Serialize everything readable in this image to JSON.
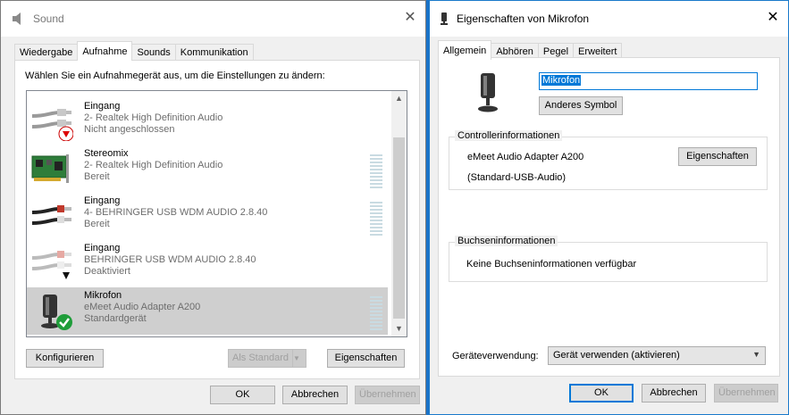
{
  "sound": {
    "title": "Sound",
    "tabs": [
      "Wiedergabe",
      "Aufnahme",
      "Sounds",
      "Kommunikation"
    ],
    "instruction": "Wählen Sie ein Aufnahmegerät aus, um die Einstellungen zu ändern:",
    "devices": [
      {
        "name": "Eingang",
        "desc": "2- Realtek High Definition Audio",
        "status": "Nicht angeschlossen",
        "icon": "rca-cable-icon",
        "badge": "red-down-arrow"
      },
      {
        "name": "Stereomix",
        "desc": "2- Realtek High Definition Audio",
        "status": "Bereit",
        "icon": "sound-card-icon",
        "badge": ""
      },
      {
        "name": "Eingang",
        "desc": "4- BEHRINGER USB WDM AUDIO 2.8.40",
        "status": "Bereit",
        "icon": "rca-cable-icon",
        "badge": ""
      },
      {
        "name": "Eingang",
        "desc": "BEHRINGER USB WDM AUDIO 2.8.40",
        "status": "Deaktiviert",
        "icon": "rca-cable-icon",
        "badge": "black-down-arrow"
      },
      {
        "name": "Mikrofon",
        "desc": "eMeet Audio Adapter A200",
        "status": "Standardgerät",
        "icon": "microphone-icon",
        "badge": "green-check"
      }
    ],
    "buttons": {
      "configure": "Konfigurieren",
      "set_default": "Als Standard",
      "properties": "Eigenschaften",
      "ok": "OK",
      "cancel": "Abbrechen",
      "apply": "Übernehmen"
    }
  },
  "props": {
    "title": "Eigenschaften von Mikrofon",
    "tabs": [
      "Allgemein",
      "Abhören",
      "Pegel",
      "Erweitert"
    ],
    "device_name": "Mikrofon",
    "change_icon": "Anderes Symbol",
    "controller": {
      "label": "Controllerinformationen",
      "name": "eMeet Audio Adapter A200",
      "driver": "(Standard-USB-Audio)",
      "properties": "Eigenschaften"
    },
    "jack": {
      "label": "Buchseninformationen",
      "text": "Keine Buchseninformationen verfügbar"
    },
    "usage": {
      "label": "Geräteverwendung:",
      "value": "Gerät verwenden (aktivieren)"
    },
    "buttons": {
      "ok": "OK",
      "cancel": "Abbrechen",
      "apply": "Übernehmen"
    }
  },
  "colors": {
    "accent": "#0078d7",
    "desktop": "#1a73c9",
    "selection": "#cfcfcf"
  }
}
